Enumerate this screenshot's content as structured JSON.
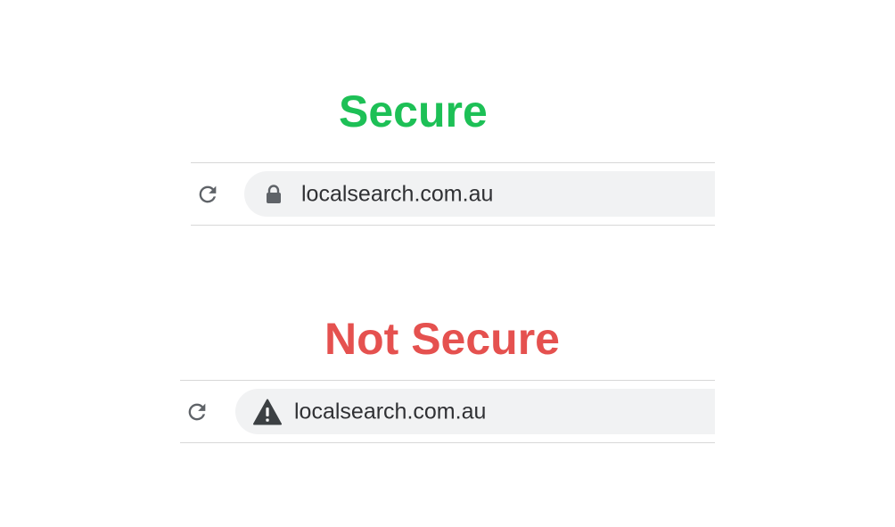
{
  "secure_example": {
    "heading": "Secure",
    "heading_color": "#1dc056",
    "url": "localsearch.com.au",
    "reload_icon": "reload-icon",
    "site_icon": "lock-icon"
  },
  "insecure_example": {
    "heading": "Not Secure",
    "heading_color": "#e5514f",
    "url": "localsearch.com.au",
    "reload_icon": "reload-icon",
    "site_icon": "warning-icon"
  }
}
